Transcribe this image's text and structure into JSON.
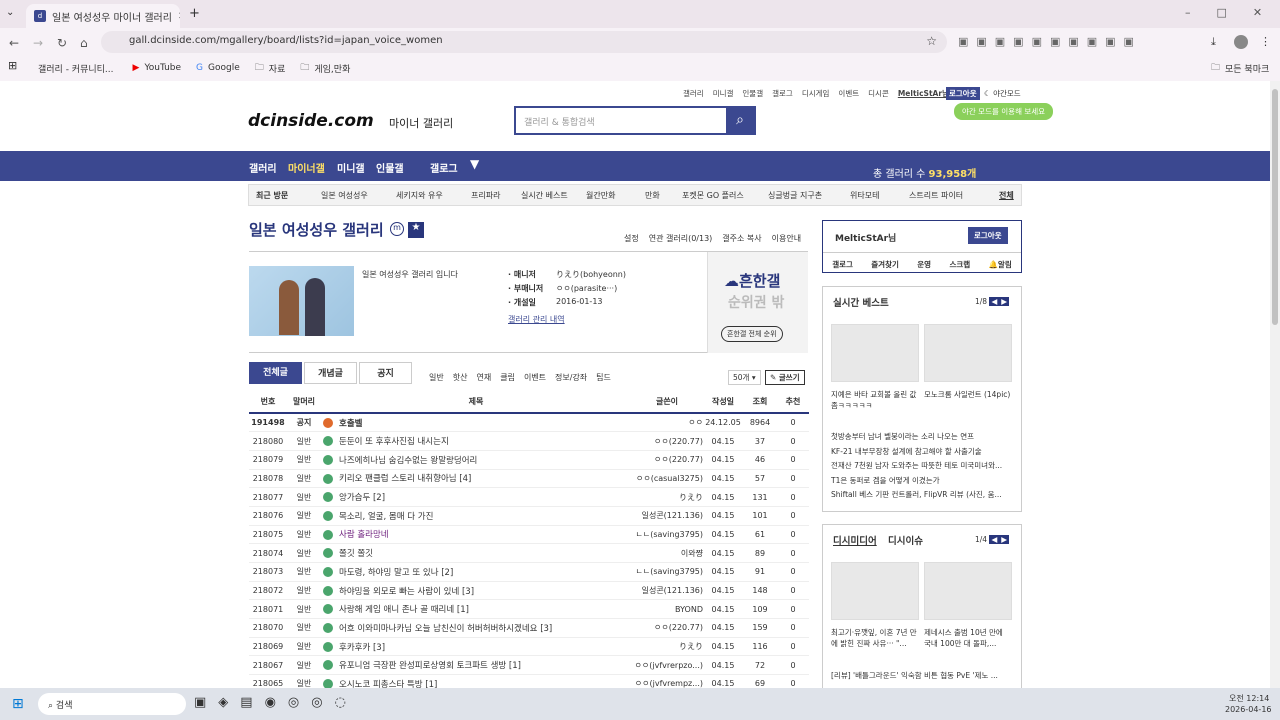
{
  "browser": {
    "tab_title": "일본 여성성우 마이너 갤러리",
    "url": "gall.dcinside.com/mgallery/board/lists?id=japan_voice_women",
    "bookmarks": [
      "갤러리 - 커뮤니티...",
      "YouTube",
      "Google",
      "자료",
      "게임,만화"
    ],
    "all_bookmarks": "모든 북마크"
  },
  "top_links": [
    "갤러리",
    "미니갤",
    "인물갤",
    "갤로그",
    "디시게임",
    "이벤트",
    "디시콘"
  ],
  "user": "MelticStAr님",
  "logout": "로그아웃",
  "night_mode": "야간모드",
  "night_tip": "야간 모드를 이용해 보세요",
  "logo": "dcinside.com",
  "logo_sub": "마이너 갤러리",
  "search_placeholder": "갤러리 & 통합검색",
  "gnb": [
    "갤러리",
    "마이너갤",
    "미니갤",
    "인물갤",
    "갤로그"
  ],
  "total_label": "총 갤러리 수",
  "total_value": "93,958개",
  "recent_label": "최근 방문",
  "recent": [
    "일본 여성성우",
    "세키지와 유우",
    "프리파라",
    "실시간 베스트",
    "월간만화",
    "만화",
    "포켓몬 GO 플러스",
    "싱글벙글 지구촌",
    "위타모테",
    "스트리트 파이터"
  ],
  "recent_all": "전체",
  "gallery": {
    "title": "일본 여성성우 갤러리",
    "desc": "일본 여성성우 갤러리 입니다",
    "manager_label": "매니저",
    "manager": "りえり(bohyeonn)",
    "sub_label": "부매니저",
    "sub": "ㅇㅇ(parasite···)",
    "open_label": "개설일",
    "open": "2016-01-13",
    "history": "갤러리 관리 내역",
    "links": [
      "설정",
      "연관 갤러리(0/13)",
      "갤주소 복사",
      "이용안내"
    ],
    "rank_title": "흔한갤",
    "rank_sub": "순위권 밖",
    "rank_btn": "흔한갤 전체 순위"
  },
  "tabs": [
    "전체글",
    "개념글",
    "공지"
  ],
  "heads": [
    "일반",
    "핫산",
    "연재",
    "클립",
    "이벤트",
    "정보/강좌",
    "팁드"
  ],
  "per_page": "50개",
  "write": "글쓰기",
  "cols": [
    "번호",
    "말머리",
    "제목",
    "글쓴이",
    "작성일",
    "조회",
    "추천"
  ],
  "rows": [
    [
      "191498",
      "공지",
      "호출벨",
      "ㅇㅇ",
      "24.12.05",
      "8964",
      "0"
    ],
    [
      "218080",
      "일반",
      "둔둔이 또 후후사진집 내시는지",
      "ㅇㅇ(220.77)",
      "04.15",
      "37",
      "0"
    ],
    [
      "218079",
      "일반",
      "나즈에히나님 숨김수없는 왕말랑덩어리",
      "ㅇㅇ(220.77)",
      "04.15",
      "46",
      "0"
    ],
    [
      "218078",
      "일반",
      "키리오 팬클럽 스토리 내취향아님 [4]",
      "ㅇㅇ(casual3275)",
      "04.15",
      "57",
      "0"
    ],
    [
      "218077",
      "일반",
      "앙가슴두 [2]",
      "りえり",
      "04.15",
      "131",
      "0"
    ],
    [
      "218076",
      "일반",
      "목소리, 얼굴, 몸매 다 가진",
      "일성콘(121.136)",
      "04.15",
      "101",
      "0"
    ],
    [
      "218075",
      "일반",
      "사람 홀라망네",
      "ㄴㄴ(saving3795)",
      "04.15",
      "61",
      "0"
    ],
    [
      "218074",
      "일반",
      "쫄깃 쫄깃",
      "이와쨩",
      "04.15",
      "89",
      "0"
    ],
    [
      "218073",
      "일반",
      "마도령, 하야밍 말고 또 있나 [2]",
      "ㄴㄴ(saving3795)",
      "04.15",
      "91",
      "0"
    ],
    [
      "218072",
      "일반",
      "하야밍을 외모로 빠는 사람이 있네 [3]",
      "일성콘(121.136)",
      "04.15",
      "148",
      "0"
    ],
    [
      "218071",
      "일반",
      "사랑해 게임 애니 존나 골 때리네 [1]",
      "BYOND",
      "04.15",
      "109",
      "0"
    ],
    [
      "218070",
      "일반",
      "어흐 이와미마나카님 오늘 남친신이 허버허버하시겠네요 [3]",
      "ㅇㅇ(220.77)",
      "04.15",
      "159",
      "0"
    ],
    [
      "218069",
      "일반",
      "후카후카 [3]",
      "りえり",
      "04.15",
      "116",
      "0"
    ],
    [
      "218067",
      "일반",
      "유포니엄 극장판 완성피로상영회 토크파트 생방 [1]",
      "ㅇㅇ(jvfvrerpzo...)",
      "04.15",
      "72",
      "0"
    ],
    [
      "218065",
      "일반",
      "오시노코 피총스타 특방 [1]",
      "ㅇㅇ(jvfvrempz...)",
      "04.15",
      "69",
      "0"
    ]
  ],
  "side": {
    "user": "MelticStAr님",
    "logout": "로그아웃",
    "menu": [
      "갤로그",
      "즐겨찾기",
      "운영",
      "스크랩",
      "알림"
    ],
    "best_title": "실시간 베스트",
    "best_page": "1/8",
    "best_caps": [
      "지예은 바타 교회볼 올린 값좀ㅋㅋㅋㅋㅋ",
      "모노크롬 사일런트 (14pic)"
    ],
    "best_list": [
      "첫방송부터 남녀 벨붕이라는 소리 나오는 연프",
      "KF-21 내부무장창 설계에 참고해야 할 사출기술",
      "전재산 7천원 남자 도와주는 따뜻한 테토 미국미녀와...",
      "T1은 동퍼로 겜을 어떻게 이겼는가",
      "Shiftall 베스 기판 컨트롤러, FlipVR 리뷰 (사진, 움..."
    ],
    "media_tabs": [
      "디시미디어",
      "디시이슈"
    ],
    "media_page": "1/4",
    "media_caps": [
      "최고기·유깻잎, 이혼 7년 만에 밝힌 진짜 사유··· \"...",
      "제네시스 출범 10년 만에 국내 100만 대 돌파,..."
    ],
    "media_list": [
      "[리뷰] '배틀그라운드' 익숙함 비튼 협동 PvE '제노 ..."
    ]
  },
  "taskbar": {
    "search": "검색",
    "time": "오전 12:14",
    "date": "2026-04-16"
  }
}
